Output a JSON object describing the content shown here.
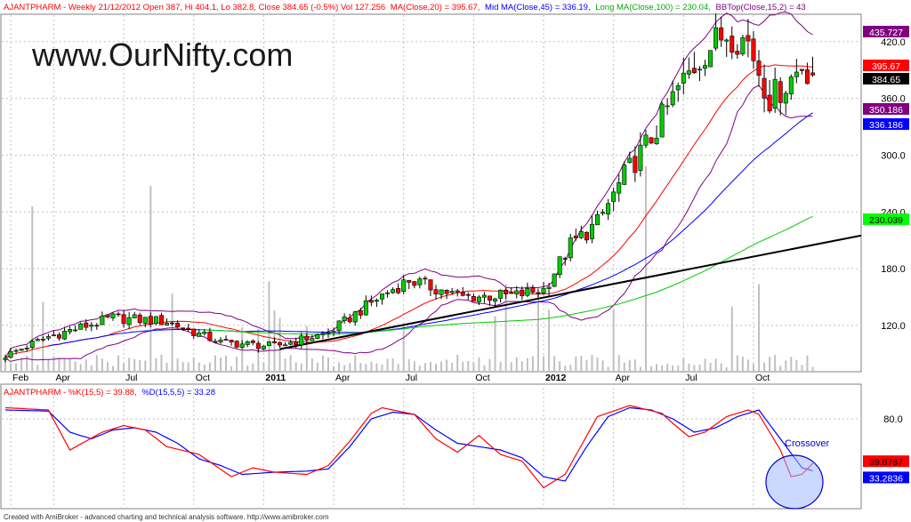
{
  "header": {
    "main_title": "AJANTPHARM - Weekly 21/12/2012 Open 387, Hi 404.1, Lo 382.8, Close 384.65 (-0.5%) Vol 127.256",
    "ma20": "MA(Close,20) = 395.67,",
    "ma45": "Mid MA(Close,45) = 336.19,",
    "ma100": "Long MA(Close,100) = 230.04,",
    "bbtop": "BBTop(Close,15,2) = 43",
    "osc_title_prefix": "AJANTPHARM - ",
    "osc_k": "%K(15,5) = 39.88,",
    "osc_d": "%D(15,5,5) = 33.28",
    "watermark": "www.OurNifty.com",
    "annotation": "Crossover",
    "footer": "Created with AmiBroker - advanced charting and technical analysis software. http://www.amibroker.com"
  },
  "price_axis": {
    "ticks": [
      {
        "label": "420.0",
        "value": 420
      },
      {
        "label": "360.0",
        "value": 360
      },
      {
        "label": "300.0",
        "value": 300
      },
      {
        "label": "240.0",
        "value": 240
      },
      {
        "label": "180.0",
        "value": 180
      },
      {
        "label": "120.0",
        "value": 120
      }
    ]
  },
  "price_badges": [
    {
      "label": "435.727",
      "value": 435.727,
      "bg": "#800080",
      "fg": "#ffffff"
    },
    {
      "label": "395.67",
      "value": 395.67,
      "bg": "#ff0000",
      "fg": "#ffffff"
    },
    {
      "label": "384.65",
      "value": 384.65,
      "bg": "#000000",
      "fg": "#ffffff"
    },
    {
      "label": "350.186",
      "value": 350.186,
      "bg": "#800080",
      "fg": "#ffffff"
    },
    {
      "label": "336.186",
      "value": 336.186,
      "bg": "#0000ff",
      "fg": "#ffffff"
    },
    {
      "label": "230.039",
      "value": 230.039,
      "bg": "#00ff00",
      "fg": "#000000"
    }
  ],
  "osc_axis": {
    "ticks": [
      {
        "label": "80.0",
        "value": 80
      }
    ]
  },
  "osc_badges": [
    {
      "label": "39.8787",
      "value": 39.8787,
      "bg": "#ff0000",
      "fg": "#000000"
    },
    {
      "label": "33.2836",
      "value": 33.2836,
      "bg": "#0000ff",
      "fg": "#ffffff"
    }
  ],
  "x_axis": {
    "labels": [
      {
        "label": "Feb",
        "week": 1,
        "bold": false
      },
      {
        "label": "Apr",
        "week": 9,
        "bold": false
      },
      {
        "label": "Jul",
        "week": 22,
        "bold": false
      },
      {
        "label": "Oct",
        "week": 35,
        "bold": false
      },
      {
        "label": "2011",
        "week": 48,
        "bold": true
      },
      {
        "label": "Apr",
        "week": 61,
        "bold": false
      },
      {
        "label": "Jul",
        "week": 74,
        "bold": false
      },
      {
        "label": "Oct",
        "week": 87,
        "bold": false
      },
      {
        "label": "2012",
        "week": 100,
        "bold": true
      },
      {
        "label": "Apr",
        "week": 113,
        "bold": false
      },
      {
        "label": "Jul",
        "week": 126,
        "bold": false
      },
      {
        "label": "Oct",
        "week": 139,
        "bold": false
      }
    ]
  },
  "colors": {
    "candle_up": "#00cc00",
    "candle_down": "#ff0000",
    "ma20": "#ff0000",
    "ma45": "#0000ff",
    "ma100": "#00cc00",
    "bollinger": "#800080",
    "volume": "#c0c0c0",
    "trendline": "#000000",
    "stoch_k": "#ff0000",
    "stoch_d": "#0000ff",
    "grid": "#c0c0c0"
  },
  "chart_data": {
    "type": "candlestick",
    "title": "AJANTPHARM - Weekly",
    "timeframe": "weekly",
    "last_bar": {
      "date": "21/12/2012",
      "open": 387,
      "high": 404.1,
      "low": 382.8,
      "close": 384.65,
      "change_pct": -0.5,
      "volume": 127.256
    },
    "price_range": [
      72,
      448
    ],
    "price_anchors": {
      "week": [
        0,
        8,
        20,
        30,
        40,
        50,
        60,
        70,
        75,
        85,
        95,
        100,
        105,
        110,
        115,
        120,
        125,
        130,
        134,
        138,
        142,
        145,
        148,
        150
      ],
      "close": [
        88,
        108,
        128,
        124,
        102,
        98,
        112,
        152,
        168,
        150,
        152,
        158,
        205,
        228,
        278,
        318,
        370,
        410,
        430,
        420,
        360,
        375,
        395,
        384.65
      ]
    },
    "indicators": {
      "ma20": 395.67,
      "ma45": 336.19,
      "ma100": 230.04,
      "bb_top": 435.727,
      "bb_bottom": 350.186
    },
    "trendline": {
      "from": {
        "week": 51,
        "price": 95
      },
      "to": {
        "week": 165,
        "price": 215
      }
    },
    "oscillator": {
      "name": "Stochastic",
      "range": [
        0,
        100
      ],
      "k_last": 39.88,
      "d_last": 33.28,
      "k_anchors": {
        "week": [
          0,
          8,
          12,
          18,
          22,
          26,
          30,
          36,
          42,
          46,
          50,
          56,
          60,
          64,
          68,
          70,
          72,
          76,
          80,
          84,
          88,
          92,
          96,
          100,
          104,
          110,
          116,
          122,
          124,
          127,
          130,
          134,
          138,
          140,
          144,
          146,
          148,
          150
        ],
        "value": [
          90,
          88,
          52,
          68,
          74,
          70,
          55,
          48,
          28,
          36,
          32,
          30,
          38,
          60,
          85,
          90,
          88,
          84,
          62,
          50,
          65,
          48,
          42,
          18,
          30,
          82,
          92,
          85,
          76,
          64,
          68,
          82,
          88,
          84,
          52,
          28,
          30,
          39.88
        ]
      },
      "d_anchors": {
        "week": [
          0,
          8,
          12,
          16,
          20,
          24,
          28,
          32,
          36,
          40,
          44,
          50,
          56,
          60,
          64,
          68,
          72,
          76,
          80,
          84,
          88,
          92,
          96,
          100,
          104,
          108,
          112,
          116,
          120,
          124,
          128,
          132,
          136,
          140,
          144,
          148,
          150
        ],
        "value": [
          88,
          87,
          68,
          62,
          70,
          72,
          68,
          58,
          44,
          38,
          30,
          32,
          33,
          35,
          55,
          80,
          86,
          84,
          70,
          58,
          55,
          52,
          45,
          28,
          24,
          55,
          82,
          90,
          88,
          80,
          68,
          72,
          82,
          88,
          62,
          36,
          33.28
        ]
      }
    }
  }
}
